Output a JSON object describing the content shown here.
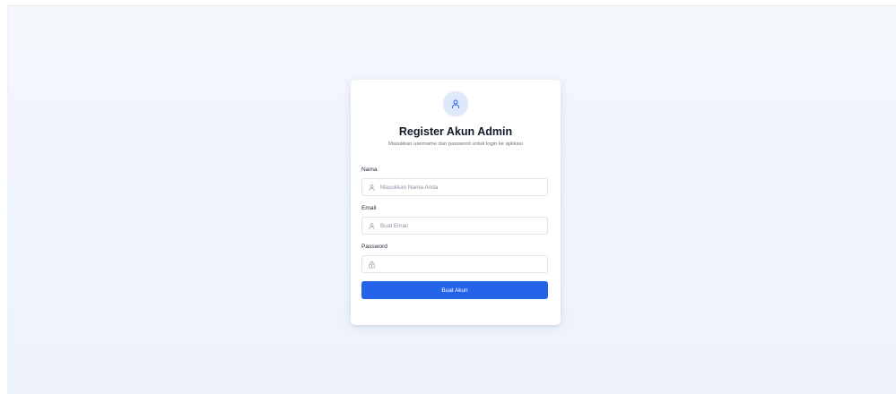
{
  "colors": {
    "page_background": "#eef3fb",
    "accent": "#2563eb",
    "avatar_background": "#dde8fb",
    "text_primary": "#111827",
    "text_muted": "#6b7280"
  },
  "form": {
    "avatar_icon": "user-icon",
    "title": "Register Akun Admin",
    "subtitle": "Masukkan username dan password untuk login ke aplikasi",
    "fields": {
      "nama": {
        "label": "Nama",
        "placeholder": "Masukkan Nama Anda",
        "value": "",
        "icon": "user-icon"
      },
      "email": {
        "label": "Email",
        "placeholder": "Buat Email",
        "value": "",
        "icon": "user-icon"
      },
      "password": {
        "label": "Password",
        "placeholder": "",
        "value": "",
        "icon": "lock-icon"
      }
    },
    "submit_label": "Buat Akun"
  }
}
